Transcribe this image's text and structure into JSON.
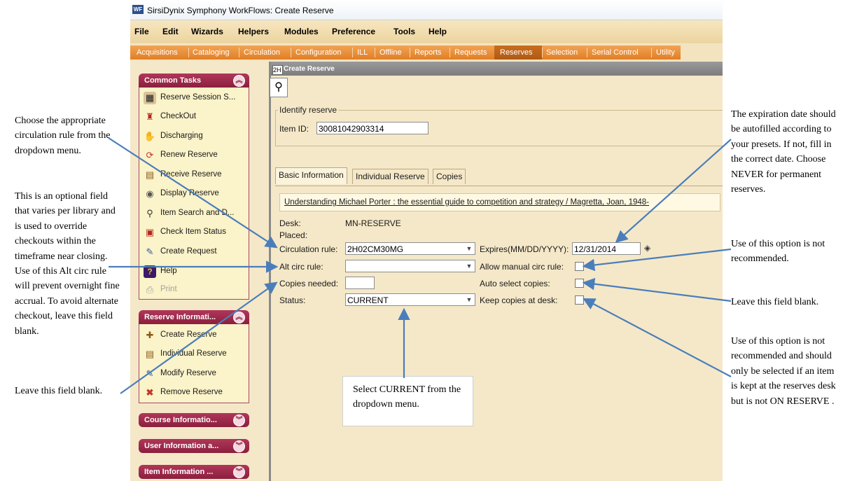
{
  "window": {
    "title": "SirsiDynix Symphony WorkFlows: Create Reserve",
    "logo": "WF"
  },
  "menu": [
    "File",
    "Edit",
    "Wizards",
    "Helpers",
    "Modules",
    "Preference",
    "Tools",
    "Help"
  ],
  "modules": [
    "Acquisitions",
    "Cataloging",
    "Circulation",
    "Configuration",
    "ILL",
    "Offline",
    "Reports",
    "Requests",
    "Reserves",
    "Selection",
    "Serial Control",
    "Utility"
  ],
  "sidebar": {
    "common_tasks": {
      "title": "Common Tasks",
      "items": [
        "Reserve Session S...",
        "CheckOut",
        "Discharging",
        "Renew Reserve",
        "Receive Reserve",
        "Display Reserve",
        "Item Search and D...",
        "Check Item Status",
        "Create Request",
        "Help",
        "Print"
      ]
    },
    "reserve_info": {
      "title": "Reserve Informati...",
      "items": [
        "Create Reserve",
        "Individual Reserve",
        "Modify Reserve",
        "Remove Reserve"
      ]
    },
    "collapsed": [
      "Course Informatio...",
      "User Information a...",
      "Item Information ..."
    ]
  },
  "main": {
    "header_box": "2H",
    "header_title": "Create Reserve",
    "identify": {
      "legend": "Identify reserve",
      "item_id_label": "Item ID:",
      "item_id_value": "30081042903314"
    },
    "tabs": [
      "Basic Information",
      "Individual Reserve",
      "Copies"
    ],
    "title_line": "Understanding Michael Porter : the essential guide to competition and strategy / Magretta, Joan, 1948-",
    "desk_label": "Desk:",
    "desk_value": "MN-RESERVE",
    "placed_label": "Placed:",
    "circ_rule_label": "Circulation rule:",
    "circ_rule_value": "2H02CM30MG",
    "alt_circ_label": "Alt circ rule:",
    "alt_circ_value": "",
    "copies_needed_label": "Copies needed:",
    "copies_needed_value": "",
    "status_label": "Status:",
    "status_value": "CURRENT",
    "expires_label": "Expires(MM/DD/YYYY):",
    "expires_value": "12/31/2014",
    "allow_manual_label": "Allow manual circ rule:",
    "auto_select_label": "Auto select copies:",
    "keep_copies_label": "Keep copies at desk:"
  },
  "annotations": {
    "circ_rule": "Choose the appropriate circulation rule from the dropdown menu.",
    "alt_circ": "This is an optional field that varies per library and is used to override checkouts within the timeframe near closing. Use of this Alt circ rule will prevent overnight fine accrual. To avoid alternate checkout, leave this field blank.",
    "copies_needed": "Leave this field blank.",
    "status": "Select CURRENT from the dropdown menu.",
    "expires": "The expiration date should be autofilled according to your presets. If not, fill in the correct date. Choose NEVER for permanent reserves.",
    "allow_manual": "Use of this option is not recommended.",
    "auto_select": "Leave this field blank.",
    "keep_copies": "Use of this option is not recommended and should only be selected if an item is kept at the reserves desk but is not ON RESERVE ."
  },
  "colors": {
    "arrow": "#4a7ebb",
    "tab_bar": "#e58a2e",
    "panel_header": "#9b2a4b",
    "app_bg": "#f5e8c8"
  }
}
